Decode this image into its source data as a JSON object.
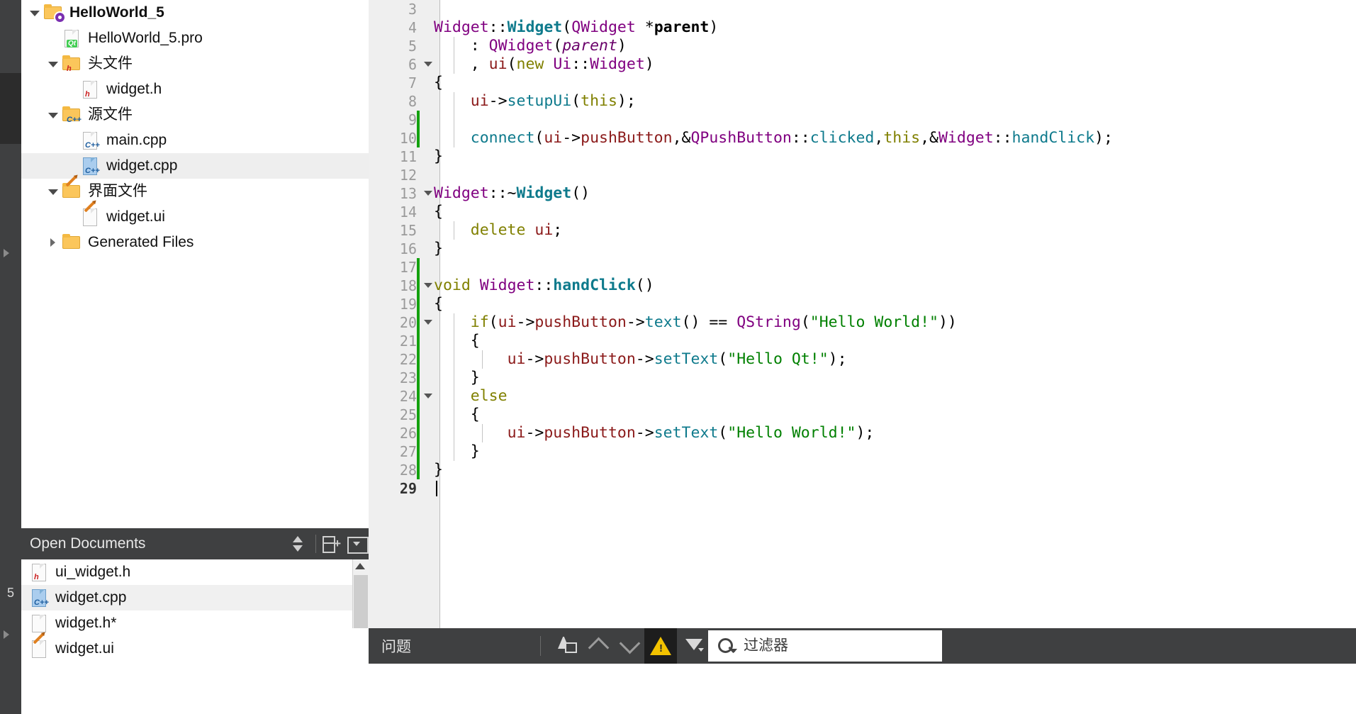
{
  "mode_bar": {
    "editor_number": "5"
  },
  "project_tree": {
    "items": [
      {
        "label": "HelloWorld_5",
        "icon": "folder-project-icon",
        "indent": 0,
        "expander": "down",
        "bold": true,
        "selected": false
      },
      {
        "label": "HelloWorld_5.pro",
        "icon": "file-qt-pro-icon",
        "indent": 1,
        "expander": "none",
        "bold": false,
        "selected": false
      },
      {
        "label": "头文件",
        "icon": "folder-headers-icon",
        "indent": 1,
        "expander": "down",
        "bold": false,
        "selected": false
      },
      {
        "label": "widget.h",
        "icon": "file-header-icon",
        "indent": 2,
        "expander": "none",
        "bold": false,
        "selected": false
      },
      {
        "label": "源文件",
        "icon": "folder-sources-icon",
        "indent": 1,
        "expander": "down",
        "bold": false,
        "selected": false
      },
      {
        "label": "main.cpp",
        "icon": "file-cpp-icon",
        "indent": 2,
        "expander": "none",
        "bold": false,
        "selected": false
      },
      {
        "label": "widget.cpp",
        "icon": "file-cpp-selected-icon",
        "indent": 2,
        "expander": "none",
        "bold": false,
        "selected": true
      },
      {
        "label": "界面文件",
        "icon": "folder-forms-icon",
        "indent": 1,
        "expander": "down",
        "bold": false,
        "selected": false
      },
      {
        "label": "widget.ui",
        "icon": "file-ui-icon",
        "indent": 2,
        "expander": "none",
        "bold": false,
        "selected": false
      },
      {
        "label": "Generated Files",
        "icon": "folder-generated-icon",
        "indent": 1,
        "expander": "right",
        "bold": false,
        "selected": false
      }
    ]
  },
  "open_documents": {
    "title": "Open Documents",
    "buttons": [
      {
        "name": "sync-with-editor-button",
        "icon": "up-down-arrows-icon"
      },
      {
        "name": "split-editor-button",
        "icon": "split-plus-icon"
      },
      {
        "name": "panel-options-button",
        "icon": "dropdown-box-icon"
      }
    ],
    "items": [
      {
        "label": "ui_widget.h",
        "icon": "file-header-icon",
        "selected": false
      },
      {
        "label": "widget.cpp",
        "icon": "file-cpp-selected-icon",
        "selected": true
      },
      {
        "label": "widget.h*",
        "icon": "file-plain-icon",
        "selected": false
      },
      {
        "label": "widget.ui",
        "icon": "file-ui-icon",
        "selected": false
      }
    ]
  },
  "editor": {
    "first_line": 3,
    "current_line": 29,
    "lines": [
      {
        "num": "3",
        "fold": false,
        "changed": false,
        "indent_guides": [],
        "tokens": []
      },
      {
        "num": "4",
        "fold": false,
        "changed": false,
        "indent_guides": [],
        "tokens": [
          {
            "t": "Widget",
            "c": "t-type"
          },
          {
            "t": "::",
            "c": "t-plain"
          },
          {
            "t": "Widget",
            "c": "t-fnb"
          },
          {
            "t": "(",
            "c": "t-plain"
          },
          {
            "t": "QWidget",
            "c": "t-type"
          },
          {
            "t": " *",
            "c": "t-plain"
          },
          {
            "t": "parent",
            "c": "t-paramb"
          },
          {
            "t": ")",
            "c": "t-plain"
          }
        ]
      },
      {
        "num": "5",
        "fold": false,
        "changed": false,
        "indent_guides": [
          120
        ],
        "tokens": [
          {
            "t": "    : ",
            "c": "t-plain"
          },
          {
            "t": "QWidget",
            "c": "t-type"
          },
          {
            "t": "(",
            "c": "t-plain"
          },
          {
            "t": "parent",
            "c": "t-param"
          },
          {
            "t": ")",
            "c": "t-plain"
          }
        ]
      },
      {
        "num": "6",
        "fold": true,
        "changed": false,
        "indent_guides": [
          120
        ],
        "tokens": [
          {
            "t": "    , ",
            "c": "t-plain"
          },
          {
            "t": "ui",
            "c": "t-member"
          },
          {
            "t": "(",
            "c": "t-plain"
          },
          {
            "t": "new",
            "c": "t-kw"
          },
          {
            "t": " ",
            "c": "t-plain"
          },
          {
            "t": "Ui",
            "c": "t-type"
          },
          {
            "t": "::",
            "c": "t-plain"
          },
          {
            "t": "Widget",
            "c": "t-type"
          },
          {
            "t": ")",
            "c": "t-plain"
          }
        ]
      },
      {
        "num": "7",
        "fold": false,
        "changed": false,
        "indent_guides": [],
        "tokens": [
          {
            "t": "{",
            "c": "t-plain"
          }
        ]
      },
      {
        "num": "8",
        "fold": false,
        "changed": false,
        "indent_guides": [
          120
        ],
        "tokens": [
          {
            "t": "    ",
            "c": "t-plain"
          },
          {
            "t": "ui",
            "c": "t-member"
          },
          {
            "t": "->",
            "c": "t-plain"
          },
          {
            "t": "setupUi",
            "c": "t-fn"
          },
          {
            "t": "(",
            "c": "t-plain"
          },
          {
            "t": "this",
            "c": "t-kw"
          },
          {
            "t": ");",
            "c": "t-plain"
          }
        ]
      },
      {
        "num": "9",
        "fold": false,
        "changed": true,
        "indent_guides": [
          120
        ],
        "tokens": []
      },
      {
        "num": "10",
        "fold": false,
        "changed": true,
        "indent_guides": [
          120
        ],
        "tokens": [
          {
            "t": "    ",
            "c": "t-plain"
          },
          {
            "t": "connect",
            "c": "t-fn"
          },
          {
            "t": "(",
            "c": "t-plain"
          },
          {
            "t": "ui",
            "c": "t-member"
          },
          {
            "t": "->",
            "c": "t-plain"
          },
          {
            "t": "pushButton",
            "c": "t-member"
          },
          {
            "t": ",&",
            "c": "t-plain"
          },
          {
            "t": "QPushButton",
            "c": "t-type"
          },
          {
            "t": "::",
            "c": "t-plain"
          },
          {
            "t": "clicked",
            "c": "t-fn"
          },
          {
            "t": ",",
            "c": "t-plain"
          },
          {
            "t": "this",
            "c": "t-kw"
          },
          {
            "t": ",&",
            "c": "t-plain"
          },
          {
            "t": "Widget",
            "c": "t-type"
          },
          {
            "t": "::",
            "c": "t-plain"
          },
          {
            "t": "handClick",
            "c": "t-fn"
          },
          {
            "t": ");",
            "c": "t-plain"
          }
        ]
      },
      {
        "num": "11",
        "fold": false,
        "changed": false,
        "indent_guides": [],
        "tokens": [
          {
            "t": "}",
            "c": "t-plain"
          }
        ]
      },
      {
        "num": "12",
        "fold": false,
        "changed": false,
        "indent_guides": [],
        "tokens": []
      },
      {
        "num": "13",
        "fold": true,
        "changed": false,
        "indent_guides": [],
        "tokens": [
          {
            "t": "Widget",
            "c": "t-type"
          },
          {
            "t": "::~",
            "c": "t-plain"
          },
          {
            "t": "Widget",
            "c": "t-fnb"
          },
          {
            "t": "()",
            "c": "t-plain"
          }
        ]
      },
      {
        "num": "14",
        "fold": false,
        "changed": false,
        "indent_guides": [],
        "tokens": [
          {
            "t": "{",
            "c": "t-plain"
          }
        ]
      },
      {
        "num": "15",
        "fold": false,
        "changed": false,
        "indent_guides": [
          120
        ],
        "tokens": [
          {
            "t": "    ",
            "c": "t-plain"
          },
          {
            "t": "delete",
            "c": "t-kw"
          },
          {
            "t": " ",
            "c": "t-plain"
          },
          {
            "t": "ui",
            "c": "t-member"
          },
          {
            "t": ";",
            "c": "t-plain"
          }
        ]
      },
      {
        "num": "16",
        "fold": false,
        "changed": false,
        "indent_guides": [],
        "tokens": [
          {
            "t": "}",
            "c": "t-plain"
          }
        ]
      },
      {
        "num": "17",
        "fold": false,
        "changed": true,
        "indent_guides": [],
        "tokens": []
      },
      {
        "num": "18",
        "fold": true,
        "changed": true,
        "indent_guides": [],
        "tokens": [
          {
            "t": "void",
            "c": "t-kw"
          },
          {
            "t": " ",
            "c": "t-plain"
          },
          {
            "t": "Widget",
            "c": "t-type"
          },
          {
            "t": "::",
            "c": "t-plain"
          },
          {
            "t": "handClick",
            "c": "t-fnb"
          },
          {
            "t": "()",
            "c": "t-plain"
          }
        ]
      },
      {
        "num": "19",
        "fold": false,
        "changed": true,
        "indent_guides": [],
        "tokens": [
          {
            "t": "{",
            "c": "t-plain"
          }
        ]
      },
      {
        "num": "20",
        "fold": true,
        "changed": true,
        "indent_guides": [
          120
        ],
        "tokens": [
          {
            "t": "    ",
            "c": "t-plain"
          },
          {
            "t": "if",
            "c": "t-kw"
          },
          {
            "t": "(",
            "c": "t-plain"
          },
          {
            "t": "ui",
            "c": "t-member"
          },
          {
            "t": "->",
            "c": "t-plain"
          },
          {
            "t": "pushButton",
            "c": "t-member"
          },
          {
            "t": "->",
            "c": "t-plain"
          },
          {
            "t": "text",
            "c": "t-fn"
          },
          {
            "t": "() == ",
            "c": "t-plain"
          },
          {
            "t": "QString",
            "c": "t-type"
          },
          {
            "t": "(",
            "c": "t-plain"
          },
          {
            "t": "\"Hello World!\"",
            "c": "t-str"
          },
          {
            "t": "))",
            "c": "t-plain"
          }
        ]
      },
      {
        "num": "21",
        "fold": false,
        "changed": true,
        "indent_guides": [
          120
        ],
        "tokens": [
          {
            "t": "    {",
            "c": "t-plain"
          }
        ]
      },
      {
        "num": "22",
        "fold": false,
        "changed": true,
        "indent_guides": [
          120,
          160
        ],
        "tokens": [
          {
            "t": "        ",
            "c": "t-plain"
          },
          {
            "t": "ui",
            "c": "t-member"
          },
          {
            "t": "->",
            "c": "t-plain"
          },
          {
            "t": "pushButton",
            "c": "t-member"
          },
          {
            "t": "->",
            "c": "t-plain"
          },
          {
            "t": "setText",
            "c": "t-fn"
          },
          {
            "t": "(",
            "c": "t-plain"
          },
          {
            "t": "\"Hello Qt!\"",
            "c": "t-str"
          },
          {
            "t": ");",
            "c": "t-plain"
          }
        ]
      },
      {
        "num": "23",
        "fold": false,
        "changed": true,
        "indent_guides": [
          120
        ],
        "tokens": [
          {
            "t": "    }",
            "c": "t-plain"
          }
        ]
      },
      {
        "num": "24",
        "fold": true,
        "changed": true,
        "indent_guides": [
          120
        ],
        "tokens": [
          {
            "t": "    ",
            "c": "t-plain"
          },
          {
            "t": "else",
            "c": "t-kw"
          }
        ]
      },
      {
        "num": "25",
        "fold": false,
        "changed": true,
        "indent_guides": [
          120
        ],
        "tokens": [
          {
            "t": "    {",
            "c": "t-plain"
          }
        ]
      },
      {
        "num": "26",
        "fold": false,
        "changed": true,
        "indent_guides": [
          120,
          160
        ],
        "tokens": [
          {
            "t": "        ",
            "c": "t-plain"
          },
          {
            "t": "ui",
            "c": "t-member"
          },
          {
            "t": "->",
            "c": "t-plain"
          },
          {
            "t": "pushButton",
            "c": "t-member"
          },
          {
            "t": "->",
            "c": "t-plain"
          },
          {
            "t": "setText",
            "c": "t-fn"
          },
          {
            "t": "(",
            "c": "t-plain"
          },
          {
            "t": "\"Hello World!\"",
            "c": "t-str"
          },
          {
            "t": ");",
            "c": "t-plain"
          }
        ]
      },
      {
        "num": "27",
        "fold": false,
        "changed": true,
        "indent_guides": [
          120
        ],
        "tokens": [
          {
            "t": "    }",
            "c": "t-plain"
          }
        ]
      },
      {
        "num": "28",
        "fold": false,
        "changed": true,
        "indent_guides": [],
        "tokens": [
          {
            "t": "}",
            "c": "t-plain"
          }
        ]
      },
      {
        "num": "29",
        "fold": false,
        "changed": false,
        "indent_guides": [],
        "current": true,
        "tokens": []
      }
    ]
  },
  "output_bar": {
    "title": "问题",
    "filter_placeholder": "过滤器",
    "buttons": [
      {
        "name": "clear-button",
        "icon": "broom-icon"
      },
      {
        "name": "previous-item-button",
        "icon": "chevron-up-icon"
      },
      {
        "name": "next-item-button",
        "icon": "chevron-down-icon"
      },
      {
        "name": "warnings-filter-button",
        "icon": "warning-triangle-icon",
        "active": true
      },
      {
        "name": "filter-button",
        "icon": "funnel-icon"
      }
    ]
  },
  "colors": {
    "panel_dark": "#3f4041",
    "selection": "#eeeeee",
    "gutter": "#efefef",
    "change_marker": "#13a10e",
    "warning": "#f2c200",
    "keyword": "#808000",
    "type": "#800080",
    "function": "#0e7a8c",
    "member": "#8b1a1a",
    "string": "#008000"
  }
}
